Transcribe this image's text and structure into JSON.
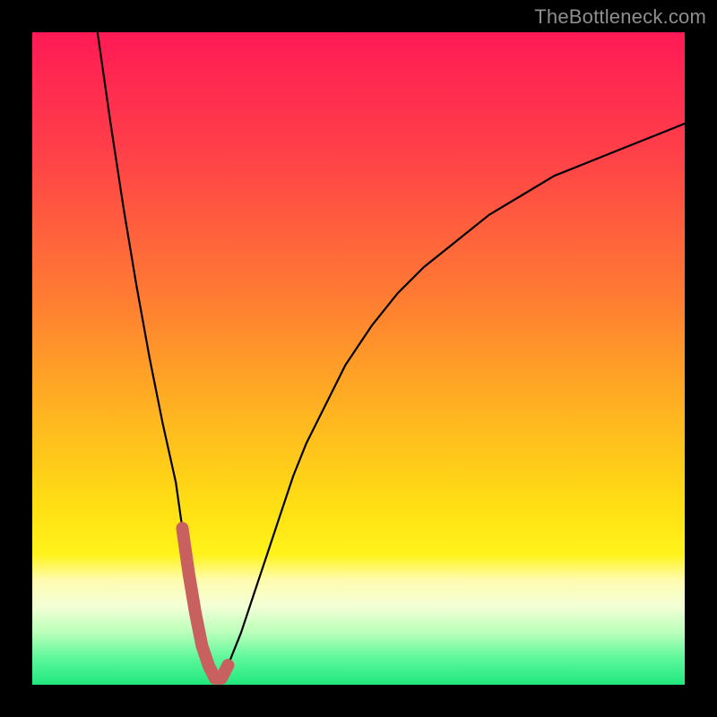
{
  "watermark": "TheBottleneck.com",
  "colors": {
    "gradient_stops": [
      {
        "offset": 0,
        "color": "#ff1a55"
      },
      {
        "offset": 18,
        "color": "#ff3f49"
      },
      {
        "offset": 40,
        "color": "#ff7a33"
      },
      {
        "offset": 60,
        "color": "#ffb91f"
      },
      {
        "offset": 73,
        "color": "#ffe014"
      },
      {
        "offset": 80,
        "color": "#fff31a"
      },
      {
        "offset": 84,
        "color": "#fffcb0"
      },
      {
        "offset": 88,
        "color": "#f3ffd6"
      },
      {
        "offset": 92,
        "color": "#b9ffb9"
      },
      {
        "offset": 96,
        "color": "#5cf79a"
      },
      {
        "offset": 100,
        "color": "#20e87e"
      }
    ],
    "curve": "#000000",
    "marker": "#c86060",
    "frame": "#000000",
    "watermark": "#8e8e8e"
  },
  "chart_data": {
    "type": "line",
    "title": "",
    "xlabel": "",
    "ylabel": "",
    "xlim": [
      0,
      100
    ],
    "ylim": [
      0,
      100
    ],
    "x": [
      10,
      12,
      14,
      16,
      18,
      20,
      22,
      23,
      24,
      25,
      26,
      27,
      28,
      29,
      30,
      32,
      34,
      36,
      38,
      40,
      42,
      45,
      48,
      52,
      56,
      60,
      65,
      70,
      75,
      80,
      85,
      90,
      95,
      100
    ],
    "values": [
      100,
      86,
      73,
      61,
      50,
      40,
      31,
      24,
      17,
      11,
      6,
      3,
      1,
      1,
      3,
      8,
      14,
      20,
      26,
      32,
      37,
      43,
      49,
      55,
      60,
      64,
      68,
      72,
      75,
      78,
      80,
      82,
      84,
      86
    ],
    "annotations": {
      "valley_marker_x_range": [
        23,
        31
      ],
      "valley_marker_y_range": [
        0,
        17
      ]
    }
  }
}
